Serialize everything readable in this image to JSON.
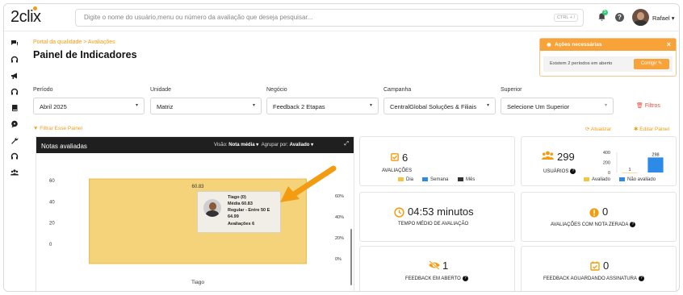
{
  "app": {
    "logo": "2clix",
    "search_placeholder": "Digite o nome do usuário,menu ou número da avaliação que deseja pesquisar...",
    "search_shortcut": "CTRL + /",
    "notification_count": "5",
    "user_name": "Rafael"
  },
  "header": {
    "breadcrumb": "Portal da qualidade > Avaliações",
    "title": "Painel de Indicadores"
  },
  "alert": {
    "title": "Ações necessárias",
    "message": "Existem 2 períodos em aberto",
    "button": "Corrigir"
  },
  "filters": {
    "periodo_label": "Período",
    "periodo_value": "Abril 2025",
    "unidade_label": "Unidade",
    "unidade_value": "Matriz",
    "negocio_label": "Negócio",
    "negocio_value": "Feedback 2 Etapas",
    "campanha_label": "Campanha",
    "campanha_value": "CentralGlobal Soluções & Filiais",
    "superior_label": "Superior",
    "superior_value": "Selecione Um Superior",
    "filtros_link": "Filtros",
    "filtrar_painel": "Filtrar Esse Painel",
    "atualizar": "Atualizar",
    "editar_painel": "Editar Painel"
  },
  "notas_panel": {
    "title": "Notas avaliadas",
    "visao_label": "Visão:",
    "visao_value": "Nota média",
    "agrupar_label": "Agrupar por:",
    "agrupar_value": "Avaliado"
  },
  "chart_data": {
    "type": "bar",
    "title": "Notas avaliadas",
    "categories": [
      "Tiago"
    ],
    "series": [
      {
        "values": [
          60.83
        ]
      }
    ],
    "data_labels": [
      "60.83"
    ],
    "y_ticks": [
      "0",
      "20",
      "40",
      "60"
    ],
    "y2_ticks": [
      "0%",
      "20%",
      "40%",
      "60%"
    ],
    "ylim": [
      0,
      70
    ],
    "tooltip": {
      "name": "Tiago (0)",
      "media": "Média 60.83",
      "regular": "Regular - Entre 50 E",
      "regular2": "64.99",
      "avaliacoes": "Avaliações 6"
    },
    "colors": {
      "bar": "#f4d37a",
      "bar_border": "#e9bb3f"
    }
  },
  "cards": {
    "avaliacoes_value": "6",
    "avaliacoes_label": "AVALIAÇÕES",
    "legend_dia": "Dia",
    "legend_semana": "Semana",
    "legend_mes": "Mês",
    "usuarios_value": "299",
    "usuarios_label": "USUÁRIOS",
    "usuarios_chart": {
      "type": "bar",
      "categories": [
        "Avaliado",
        "Não avaliado"
      ],
      "values": [
        1,
        298
      ],
      "y_ticks": [
        "0",
        "200",
        "400"
      ],
      "ylim": [
        0,
        400
      ]
    },
    "legend_avaliado": "Avaliado",
    "legend_nao_avaliado": "Não avaliado",
    "tempo_value": "04:53 minutos",
    "tempo_label": "TEMPO MÉDIO DE AVALIAÇÃO",
    "zerada_value": "0",
    "zerada_label": "AVALIAÇÕES COM NOTA ZERADA",
    "feedback_aberto_value": "1",
    "feedback_aberto_label": "FEEDBACK EM ABERTO",
    "feedback_assinatura_value": "0",
    "feedback_assinatura_label": "FEEDBACK AGUARDANDO ASSINATURA"
  },
  "colors": {
    "accent": "#f39c12",
    "danger": "#e74c3c",
    "blue": "#2d8ae6",
    "yellow": "#f4c542",
    "dark": "#1f1f1f"
  }
}
